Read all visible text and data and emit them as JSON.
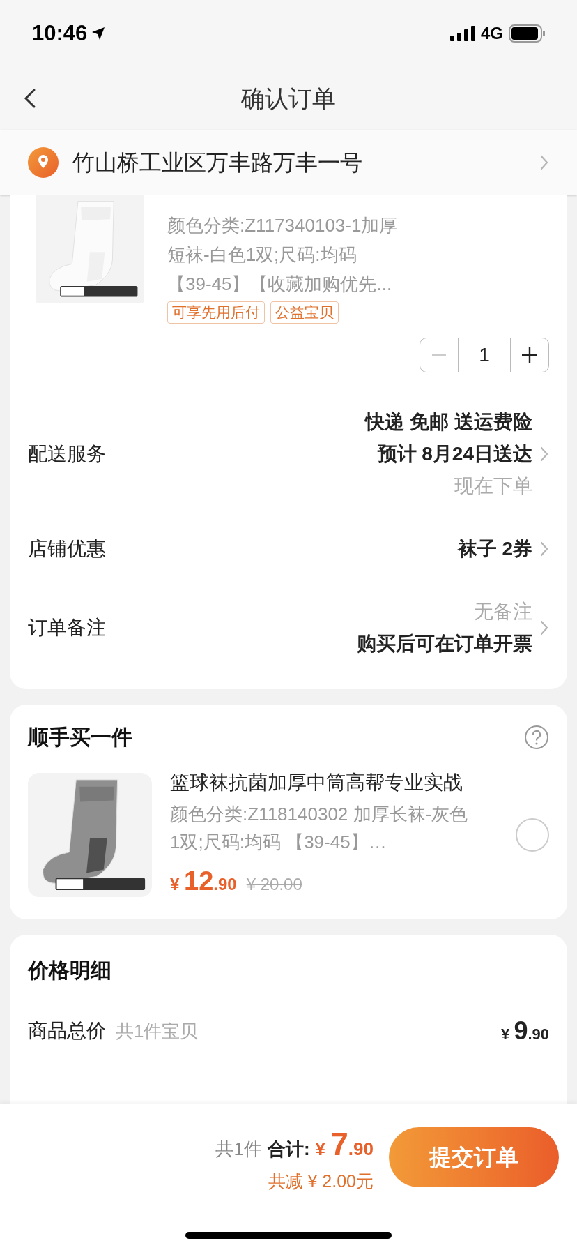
{
  "status_bar": {
    "time": "10:46",
    "network": "4G"
  },
  "nav": {
    "title": "确认订单"
  },
  "address": {
    "text": "竹山桥工业区万丰路万丰一号"
  },
  "product": {
    "specs": [
      "颜色分类:Z117340103-1加厚",
      "短袜-白色1双;尺码:均码",
      "【39-45】【收藏加购优先..."
    ],
    "tags": [
      "可享先用后付",
      "公益宝贝"
    ],
    "quantity": "1"
  },
  "order_rows": [
    {
      "label": "配送服务",
      "lines": [
        {
          "text": "快递 免邮 送运费险",
          "kind": "strong"
        },
        {
          "text": "预计 8月24日送达",
          "kind": "strong"
        },
        {
          "text": "现在下单",
          "kind": "muted"
        }
      ]
    },
    {
      "label": "店铺优惠",
      "lines": [
        {
          "text": "袜子 2券",
          "kind": "strong"
        }
      ]
    },
    {
      "label": "订单备注",
      "lines": [
        {
          "text": "无备注",
          "kind": "muted"
        },
        {
          "text": "购买后可在订单开票",
          "kind": "strong"
        }
      ]
    }
  ],
  "add_on": {
    "title": "顺手买一件",
    "item": {
      "title": "篮球袜抗菌加厚中筒高帮专业实战",
      "specs": "颜色分类:Z118140302 加厚长袜-灰色1双;尺码:均码 【39-45】…",
      "symbol": "¥",
      "int": "12",
      "dec": ".90",
      "original": "¥ 20.00",
      "selected": false
    }
  },
  "price_detail": {
    "title": "价格明细",
    "rows": [
      {
        "label": "商品总价",
        "note": "共1件宝贝",
        "symbol": "¥",
        "int": "9",
        "dec": ".90"
      }
    ]
  },
  "footer": {
    "count": "共1件",
    "total_label": "合计:",
    "symbol": "¥",
    "int": "7",
    "dec": ".90",
    "saving": "共减 ¥ 2.00元",
    "submit": "提交订单"
  }
}
